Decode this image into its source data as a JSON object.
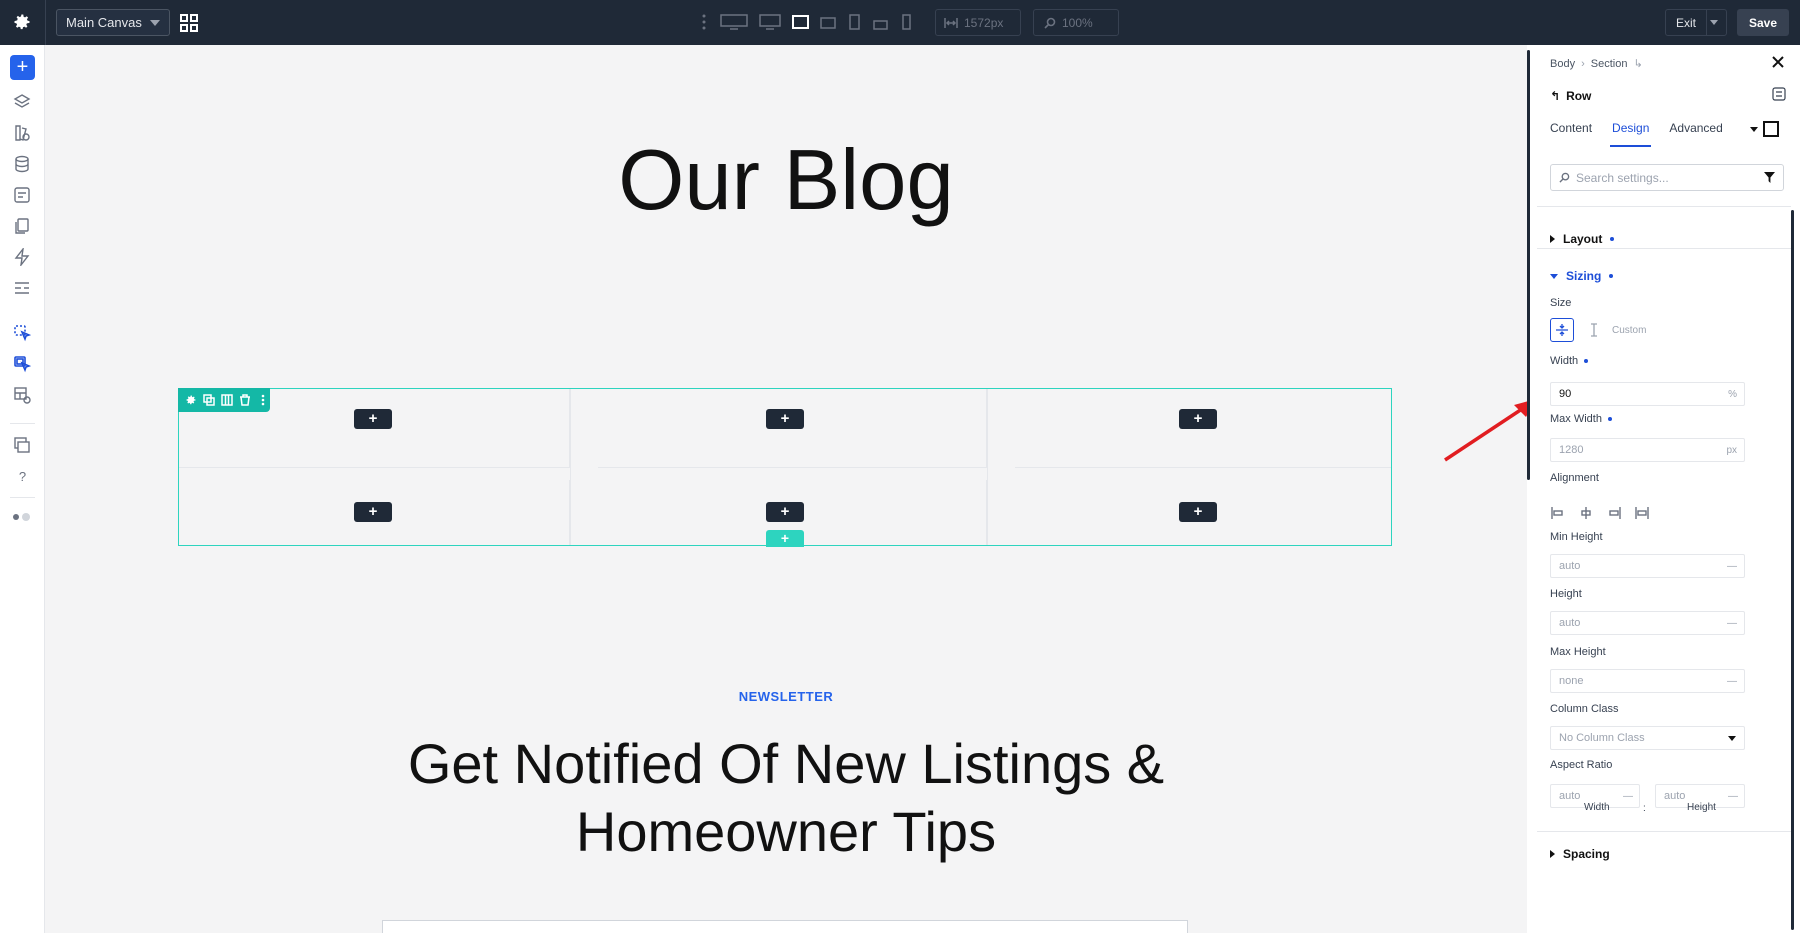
{
  "topbar": {
    "canvas_select": "Main Canvas",
    "width_value": "1572px",
    "zoom_value": "100%",
    "exit_label": "Exit",
    "save_label": "Save"
  },
  "canvas": {
    "title": "Our Blog",
    "eyebrow": "NEWSLETTER",
    "headline": "Get Notified Of New Listings & Homeowner Tips",
    "plus_label": "+"
  },
  "panel": {
    "breadcrumb": [
      "Body",
      "Section"
    ],
    "element": "Row",
    "tabs": [
      "Content",
      "Design",
      "Advanced"
    ],
    "active_tab": "Design",
    "search_placeholder": "Search settings...",
    "sections": {
      "layout": "Layout",
      "sizing": "Sizing",
      "spacing": "Spacing"
    },
    "size_label": "Size",
    "custom_label": "Custom",
    "width": {
      "label": "Width",
      "value": "90",
      "unit": "%"
    },
    "max_width": {
      "label": "Max Width",
      "placeholder": "1280",
      "unit": "px"
    },
    "alignment_label": "Alignment",
    "min_height": {
      "label": "Min Height",
      "placeholder": "auto",
      "unit": "—"
    },
    "height": {
      "label": "Height",
      "placeholder": "auto",
      "unit": "—"
    },
    "max_height": {
      "label": "Max Height",
      "placeholder": "none",
      "unit": "—"
    },
    "column_class": {
      "label": "Column Class",
      "value": "No Column Class"
    },
    "aspect_ratio": {
      "label": "Aspect Ratio",
      "width_placeholder": "auto",
      "height_placeholder": "auto",
      "unit": "—",
      "width_sub": "Width",
      "height_sub": "Height",
      "separator": ":"
    }
  },
  "colors": {
    "accent": "#1d4ed8",
    "row_highlight": "#14b8a6",
    "topbar": "#1f2937",
    "annotation_arrow": "#e11d21"
  }
}
